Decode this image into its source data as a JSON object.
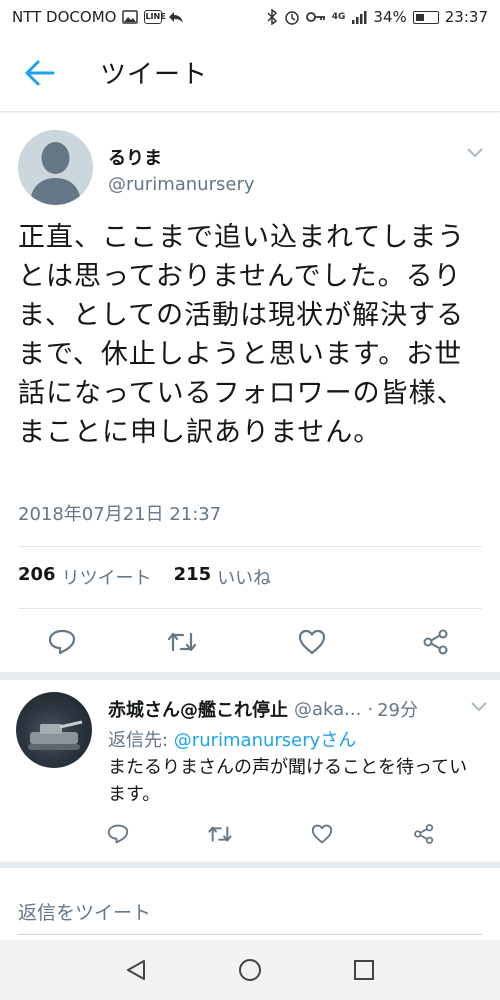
{
  "status_bar": {
    "carrier": "NTT DOCOMO",
    "line_badge": "LINE",
    "network": "4G",
    "battery": "34%",
    "time": "23:37"
  },
  "header": {
    "title": "ツイート"
  },
  "tweet": {
    "name": "るりま",
    "handle": "@rurimanursery",
    "text": "正直、ここまで追い込まれてしまうとは思っておりませんでした。るりま、としての活動は現状が解決するまで、休止しようと思います。お世話になっているフォロワーの皆様、まことに申し訳ありません。",
    "timestamp": "2018年07月21日 21:37",
    "retweet_count": "206",
    "retweet_label": "リツイート",
    "like_count": "215",
    "like_label": "いいね"
  },
  "reply": {
    "name": "赤城さん@艦これ停止",
    "handle": "@aka...",
    "dot": "·",
    "time": "29分",
    "reply_to_label": "返信先: ",
    "reply_to_handle": "@rurimanurseryさん",
    "text": "またるりまさんの声が聞けることを待っています。"
  },
  "composer": {
    "placeholder": "返信をツイート"
  },
  "colors": {
    "accent": "#1da1f2",
    "secondary_text": "#657786",
    "icon": "#657786"
  }
}
